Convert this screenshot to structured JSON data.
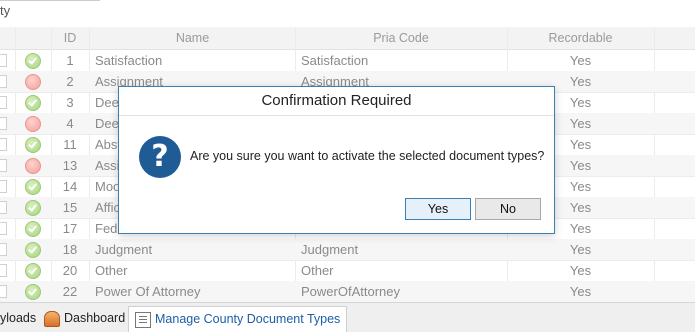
{
  "top": {
    "label": "ty"
  },
  "grid": {
    "columns": {
      "id": "ID",
      "name": "Name",
      "pria": "Pria Code",
      "recordable": "Recordable"
    },
    "rows": [
      {
        "status": "green",
        "id": "1",
        "name": "Satisfaction",
        "pria": "Satisfaction",
        "recordable": "Yes"
      },
      {
        "status": "red",
        "id": "2",
        "name": "Assignment",
        "pria": "Assignment",
        "recordable": "Yes"
      },
      {
        "status": "green",
        "id": "3",
        "name": "Dee",
        "pria": "",
        "recordable": "Yes"
      },
      {
        "status": "red",
        "id": "4",
        "name": "Dee",
        "pria": "",
        "recordable": "Yes"
      },
      {
        "status": "green",
        "id": "11",
        "name": "Abst",
        "pria": "",
        "recordable": "Yes"
      },
      {
        "status": "red",
        "id": "13",
        "name": "Assi",
        "pria": "",
        "recordable": "Yes"
      },
      {
        "status": "green",
        "id": "14",
        "name": "Moo",
        "pria": "",
        "recordable": "Yes"
      },
      {
        "status": "green",
        "id": "15",
        "name": "Affic",
        "pria": "",
        "recordable": "Yes"
      },
      {
        "status": "green",
        "id": "17",
        "name": "Fede",
        "pria": "",
        "recordable": "Yes"
      },
      {
        "status": "green",
        "id": "18",
        "name": "Judgment",
        "pria": "Judgment",
        "recordable": "Yes"
      },
      {
        "status": "green",
        "id": "20",
        "name": "Other",
        "pria": "Other",
        "recordable": "Yes"
      },
      {
        "status": "green",
        "id": "22",
        "name": "Power Of Attorney",
        "pria": "PowerOfAttorney",
        "recordable": "Yes"
      }
    ]
  },
  "dialog": {
    "title": "Confirmation Required",
    "message": "Are you sure you want to activate the selected document types?",
    "yes_label": "Yes",
    "no_label": "No",
    "icon": "question-icon"
  },
  "tabs": [
    {
      "label": "yloads",
      "icon": ""
    },
    {
      "label": "Dashboard",
      "icon": "dashboard-icon"
    },
    {
      "label": "Manage County Document Types",
      "icon": "document-list-icon",
      "active": true
    }
  ],
  "colors": {
    "accent": "#1c5ea8",
    "dialog_border": "#3c7fb1",
    "status_green": "#a6d47e",
    "status_red": "#f2a09a"
  }
}
